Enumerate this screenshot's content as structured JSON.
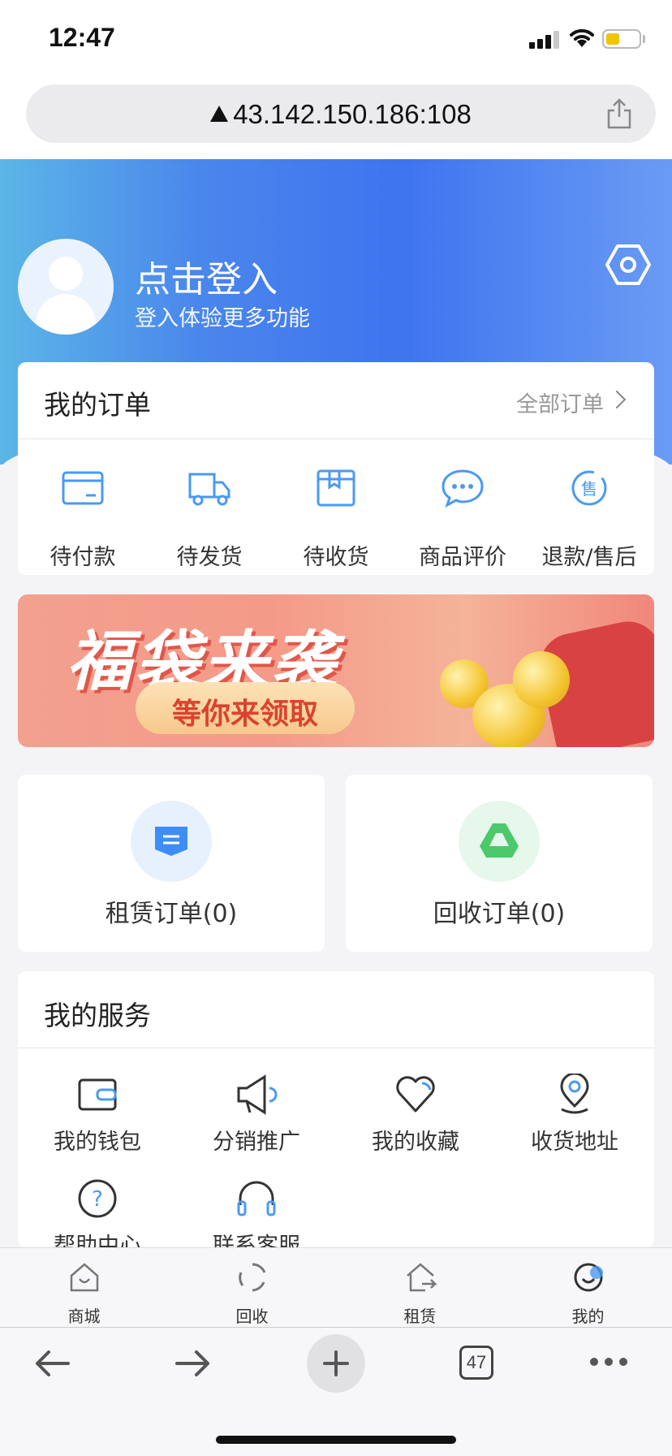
{
  "status_bar": {
    "time": "12:47"
  },
  "browser": {
    "url": "43.142.150.186:108",
    "tab_count": "47"
  },
  "profile": {
    "title": "点击登入",
    "subtitle": "登入体验更多功能"
  },
  "orders": {
    "title": "我的订单",
    "all_label": "全部订单",
    "items": [
      {
        "label": "待付款",
        "icon": "wallet-card-icon"
      },
      {
        "label": "待发货",
        "icon": "truck-icon"
      },
      {
        "label": "待收货",
        "icon": "package-icon"
      },
      {
        "label": "商品评价",
        "icon": "comment-icon"
      },
      {
        "label": "退款/售后",
        "icon": "after-sale-icon"
      }
    ]
  },
  "banner": {
    "title": "福袋来袭",
    "button": "等你来领取"
  },
  "quick_orders": [
    {
      "label": "租赁订单(0)",
      "icon": "rental-order-icon",
      "color": "#3d8df5"
    },
    {
      "label": "回收订单(0)",
      "icon": "recycle-order-icon",
      "color": "#4cc96b"
    }
  ],
  "services": {
    "title": "我的服务",
    "items": [
      {
        "label": "我的钱包",
        "icon": "wallet-icon"
      },
      {
        "label": "分销推广",
        "icon": "megaphone-icon"
      },
      {
        "label": "我的收藏",
        "icon": "heart-icon"
      },
      {
        "label": "收货地址",
        "icon": "location-icon"
      },
      {
        "label": "帮助中心",
        "icon": "help-icon"
      },
      {
        "label": "联系客服",
        "icon": "headset-icon"
      }
    ]
  },
  "tabbar": [
    {
      "label": "商城",
      "icon": "shop-icon"
    },
    {
      "label": "回收",
      "icon": "recycle-icon"
    },
    {
      "label": "租赁",
      "icon": "rent-icon"
    },
    {
      "label": "我的",
      "icon": "profile-icon",
      "active": true
    }
  ],
  "colors": {
    "accent": "#3e74ef",
    "accent_light": "#5bb6e6",
    "icon_blue": "#4a9af0"
  }
}
